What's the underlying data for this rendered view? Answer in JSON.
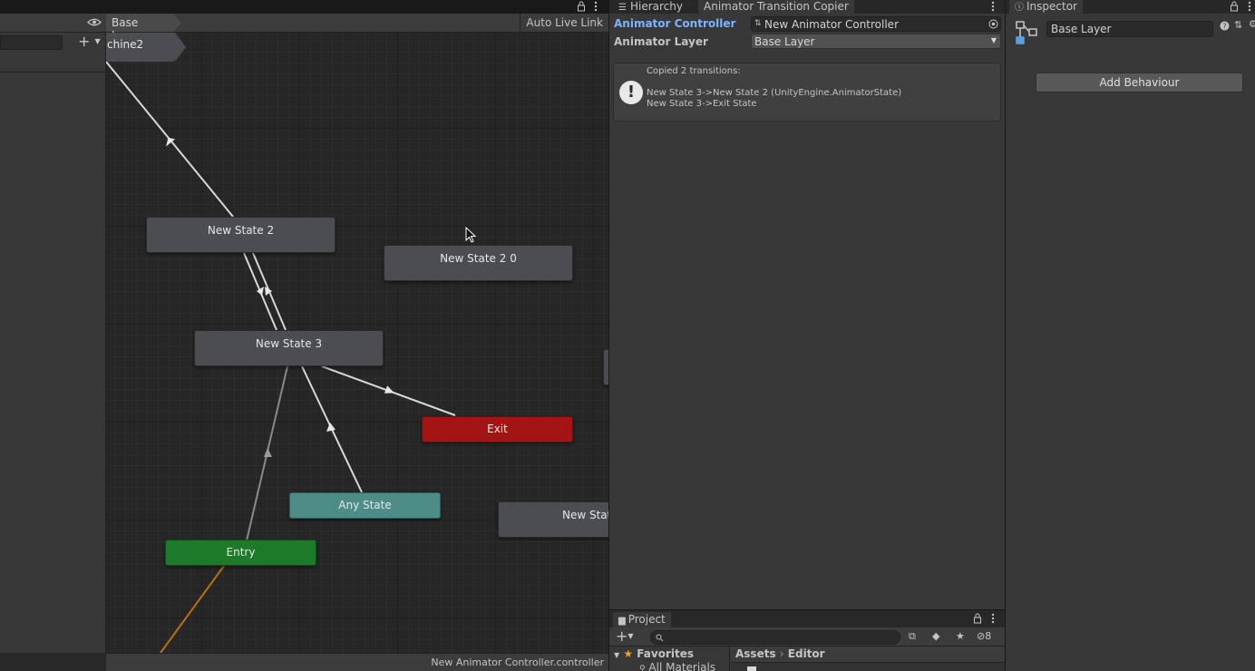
{
  "animator": {
    "breadcrumb": "Base Layer",
    "auto_live_link": "Auto Live Link",
    "add_param": "+",
    "status_file": "New Animator Controller.controller",
    "sub_state_machine_label": "chine2",
    "states": {
      "new_state_2": "New State 2",
      "new_state_2_0": "New State 2 0",
      "new_state_3": "New State 3",
      "exit": "Exit",
      "any_state": "Any State",
      "entry": "Entry",
      "new_state_partial": "New Stat"
    }
  },
  "copier": {
    "tabs": [
      "Hierarchy",
      "Animator Transition Copier"
    ],
    "controller_label": "Animator Controller",
    "controller_value": "New Animator Controller",
    "layer_label": "Animator Layer",
    "layer_value": "Base Layer",
    "message_title": "Copied 2 transitions:",
    "message_lines": [
      "New State 3->New State 2 (UnityEngine.AnimatorState)",
      "New State 3->Exit State"
    ]
  },
  "project": {
    "tab": "Project",
    "favorites": "Favorites",
    "all_materials": "All Materials",
    "breadcrumb_root": "Assets",
    "breadcrumb_child": "Editor",
    "hidden_count": "8"
  },
  "inspector": {
    "tab": "Inspector",
    "name_value": "Base Layer",
    "add_behaviour": "Add Behaviour"
  },
  "colors": {
    "exit": "#a31515",
    "any_state": "#4e8d87",
    "entry": "#1c7a28",
    "accent_label": "#7cb4ff"
  }
}
